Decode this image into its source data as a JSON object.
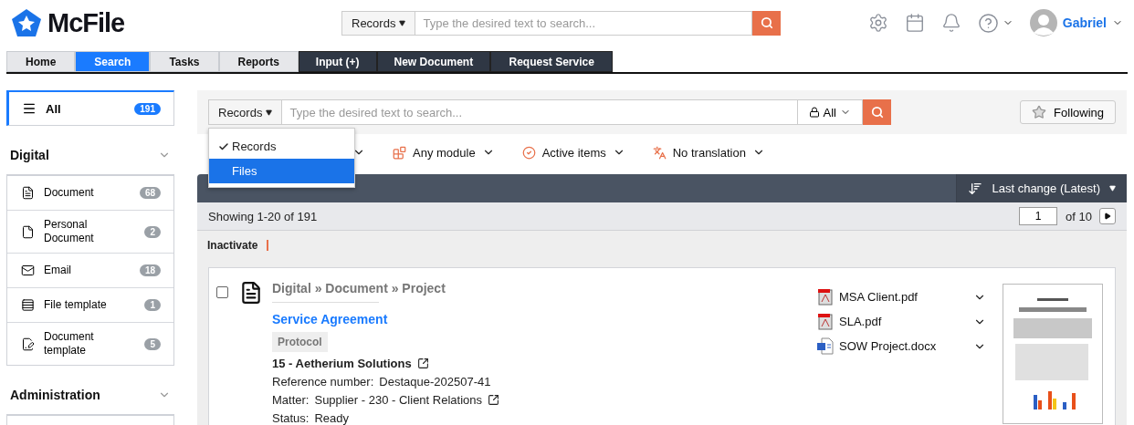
{
  "header": {
    "logo": "McFile",
    "search": {
      "scope": "Records",
      "placeholder": "Type the desired text to search..."
    },
    "user": "Gabriel"
  },
  "nav_tabs": [
    {
      "label": "Home",
      "selected": false,
      "kind": "light"
    },
    {
      "label": "Search",
      "selected": true,
      "kind": "light"
    },
    {
      "label": "Tasks",
      "selected": false,
      "kind": "light"
    },
    {
      "label": "Reports",
      "selected": false,
      "kind": "light"
    },
    {
      "label": "Input (+)",
      "selected": false,
      "kind": "dark"
    },
    {
      "label": "New Document",
      "selected": false,
      "kind": "dark"
    },
    {
      "label": "Request Service",
      "selected": false,
      "kind": "dark"
    }
  ],
  "sidebar": {
    "all": {
      "label": "All",
      "count": "191",
      "selected": true
    },
    "sections": [
      {
        "title": "Digital",
        "items": [
          {
            "label": "Document",
            "count": "68"
          },
          {
            "label": "Personal Document",
            "count": "2"
          },
          {
            "label": "Email",
            "count": "18"
          },
          {
            "label": "File template",
            "count": "1"
          },
          {
            "label": "Document template",
            "count": "5"
          }
        ]
      },
      {
        "title": "Administration"
      }
    ]
  },
  "search_bar": {
    "scope": "Records",
    "placeholder": "Type the desired text to search...",
    "access": "All",
    "following": "Following"
  },
  "scope_menu": [
    {
      "label": "Records",
      "checked": true,
      "selected": false
    },
    {
      "label": "Files",
      "checked": false,
      "selected": true
    }
  ],
  "filters": [
    "Any module",
    "Active items",
    "No translation"
  ],
  "list": {
    "sort": "Last change (Latest)",
    "showing": "Showing 1-20 of 191",
    "page": "1",
    "page_total": "of 10",
    "actions": [
      "Inactivate"
    ]
  },
  "record": {
    "checked": false,
    "breadcrumb": "Digital » Document » Project",
    "title": "Service Agreement",
    "tag": "Protocol",
    "company": "15 - Aetherium Solutions",
    "fields": [
      {
        "label": "Reference number:",
        "value": "Destaque-202507-41",
        "link": false
      },
      {
        "label": "Matter:",
        "value": "Supplier - 230 - Client Relations",
        "link": true
      },
      {
        "label": "Status:",
        "value": "Ready",
        "link": false
      }
    ],
    "files": [
      {
        "name": "MSA Client.pdf",
        "kind": "pdf"
      },
      {
        "name": "SLA.pdf",
        "kind": "pdf"
      },
      {
        "name": "SOW Project.docx",
        "kind": "docx"
      }
    ]
  }
}
